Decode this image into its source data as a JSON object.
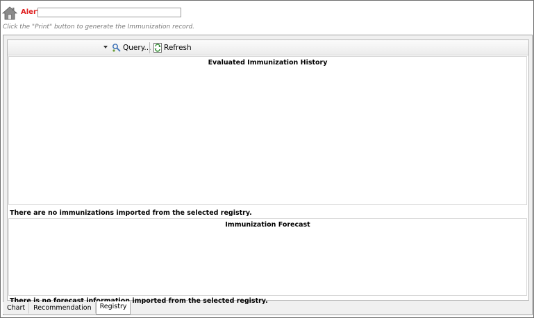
{
  "header": {
    "alert_label": "Alert:",
    "alert_value": "",
    "hint": "Click the \"Print\" button to generate the Immunization record."
  },
  "toolbar": {
    "query_label": "Query...",
    "refresh_label": "Refresh"
  },
  "history": {
    "title": "Evaluated Immunization History",
    "message": "There are no immunizations imported from the selected registry."
  },
  "forecast": {
    "title": "Immunization Forecast",
    "message": "There is no forecast information imported from the selected registry."
  },
  "tabs": [
    {
      "label": "Chart",
      "active": false
    },
    {
      "label": "Recommendation",
      "active": false
    },
    {
      "label": "Registry",
      "active": true
    }
  ],
  "colors": {
    "alert_red": "#e02020",
    "hint_gray": "#7a7a7a"
  },
  "icons": {
    "home": "home-icon",
    "query": "query-icon",
    "refresh": "refresh-icon",
    "dropdown": "chevron-down-icon"
  }
}
